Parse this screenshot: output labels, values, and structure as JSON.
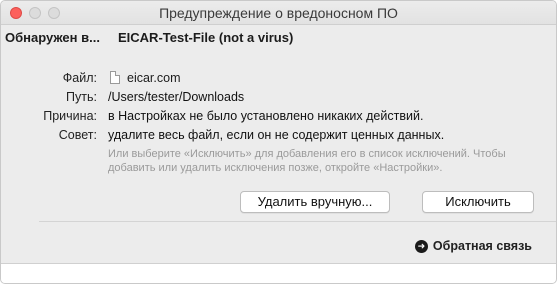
{
  "window": {
    "title": "Предупреждение о вредоносном ПО"
  },
  "detection": {
    "label": "Обнаружен в...",
    "name": "EICAR-Test-File (not a virus)"
  },
  "details": {
    "file_label": "Файл:",
    "file_value": "eicar.com",
    "path_label": "Путь:",
    "path_value": "/Users/tester/Downloads",
    "reason_label": "Причина:",
    "reason_value": "в Настройках не было установлено никаких действий.",
    "advice_label": "Совет:",
    "advice_value": "удалите весь файл, если он не содержит ценных данных.",
    "hint": "Или выберите «Исключить» для добавления его в список исключений. Чтобы добавить или удалить исключения позже, откройте «Настройки»."
  },
  "buttons": {
    "delete_manually": "Удалить вручную...",
    "exclude": "Исключить"
  },
  "footer": {
    "feedback": "Обратная связь"
  },
  "colors": {
    "close": "#fc605c",
    "window_bg": "#ececec"
  }
}
